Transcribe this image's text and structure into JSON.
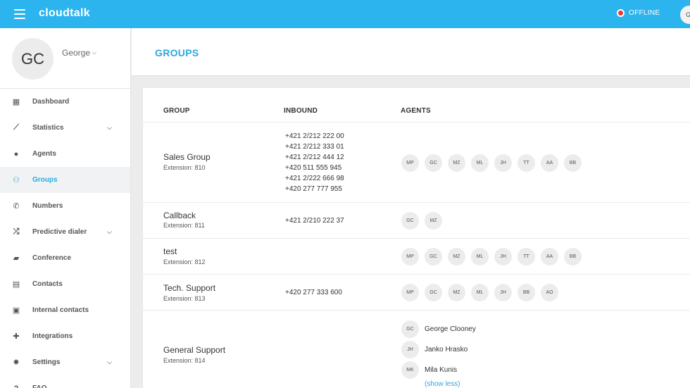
{
  "topbar": {
    "app_name": "cloudtalk",
    "status_label": "OFFLINE",
    "status_color": "#e53935",
    "accent_color": "#2cb4ef",
    "user_initials": "G"
  },
  "sidebar": {
    "profile": {
      "initials": "GC",
      "name": "George"
    },
    "items": [
      {
        "label": "Dashboard",
        "icon": "dashboard-icon",
        "has_submenu": false,
        "active": false
      },
      {
        "label": "Statistics",
        "icon": "trending-icon",
        "has_submenu": true,
        "active": false
      },
      {
        "label": "Agents",
        "icon": "person-icon",
        "has_submenu": false,
        "active": false
      },
      {
        "label": "Groups",
        "icon": "people-icon",
        "has_submenu": false,
        "active": true
      },
      {
        "label": "Numbers",
        "icon": "phone-icon",
        "has_submenu": false,
        "active": false
      },
      {
        "label": "Predictive dialer",
        "icon": "shuffle-icon",
        "has_submenu": true,
        "active": false
      },
      {
        "label": "Conference",
        "icon": "chat-icon",
        "has_submenu": false,
        "active": false
      },
      {
        "label": "Contacts",
        "icon": "contacts-icon",
        "has_submenu": false,
        "active": false
      },
      {
        "label": "Internal contacts",
        "icon": "contact-card-icon",
        "has_submenu": false,
        "active": false
      },
      {
        "label": "Integrations",
        "icon": "puzzle-icon",
        "has_submenu": false,
        "active": false
      },
      {
        "label": "Settings",
        "icon": "gear-icon",
        "has_submenu": true,
        "active": false
      },
      {
        "label": "FAQ",
        "icon": "help-icon",
        "has_submenu": false,
        "active": false
      }
    ]
  },
  "page": {
    "title": "GROUPS"
  },
  "table": {
    "headers": {
      "group": "GROUP",
      "inbound": "INBOUND",
      "agents": "AGENTS"
    },
    "rows": [
      {
        "name": "Sales Group",
        "extension": "Extension: 810",
        "numbers": [
          "+421 2/212 222 00",
          "+421 2/212 333 01",
          "+421 2/212 444 12",
          "+420 511 555 945",
          "+421 2/222 666 98",
          "+420 277 777 955"
        ],
        "agents": [
          "MP",
          "GC",
          "MZ",
          "ML",
          "JH",
          "TT",
          "AA",
          "BB"
        ]
      },
      {
        "name": "Callback",
        "extension": "Extension: 811",
        "numbers": [
          "+421 2/210 222 37"
        ],
        "agents": [
          "GC",
          "MZ"
        ]
      },
      {
        "name": "test",
        "extension": "Extension: 812",
        "numbers": [],
        "agents": [
          "MP",
          "GC",
          "MZ",
          "ML",
          "JH",
          "TT",
          "AA",
          "BB"
        ]
      },
      {
        "name": "Tech. Support",
        "extension": "Extension: 813",
        "numbers": [
          "+420 277 333 600"
        ],
        "agents": [
          "MP",
          "GC",
          "MZ",
          "ML",
          "JH",
          "BB",
          "AO"
        ]
      },
      {
        "name": "General Support",
        "extension": "Extension: 814",
        "numbers": [],
        "agent_list": [
          {
            "initials": "GC",
            "name": "George Clooney"
          },
          {
            "initials": "JH",
            "name": "Janko Hrasko"
          },
          {
            "initials": "MK",
            "name": "Mila Kunis"
          }
        ],
        "show_less": "(show less)"
      }
    ]
  }
}
